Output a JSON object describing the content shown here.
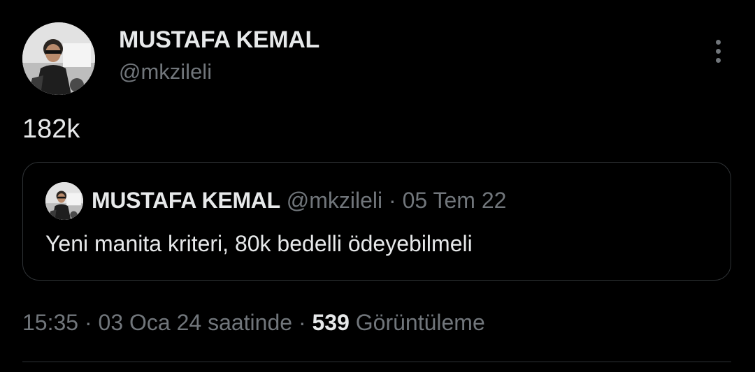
{
  "author": {
    "display_name": "MUSTAFA KEMAL",
    "handle": "@mkzileli",
    "avatar": "profile-photo"
  },
  "tweet": {
    "text": "182k",
    "more_icon": "more-dots-vertical-icon"
  },
  "quoted_tweet": {
    "display_name": "MUSTAFA KEMAL",
    "handle": "@mkzileli",
    "separator": " · ",
    "date": "05 Tem 22",
    "text": "Yeni manita kriteri, 80k bedelli ödeyebilmeli"
  },
  "meta": {
    "time": "15:35",
    "separator": " · ",
    "date": "03 Oca 24 saatinde",
    "views_count": "539",
    "views_label": "Görüntüleme"
  },
  "colors": {
    "background": "#000000",
    "primary_text": "#e7e9ea",
    "secondary_text": "#71767b",
    "border": "#2f3336"
  }
}
